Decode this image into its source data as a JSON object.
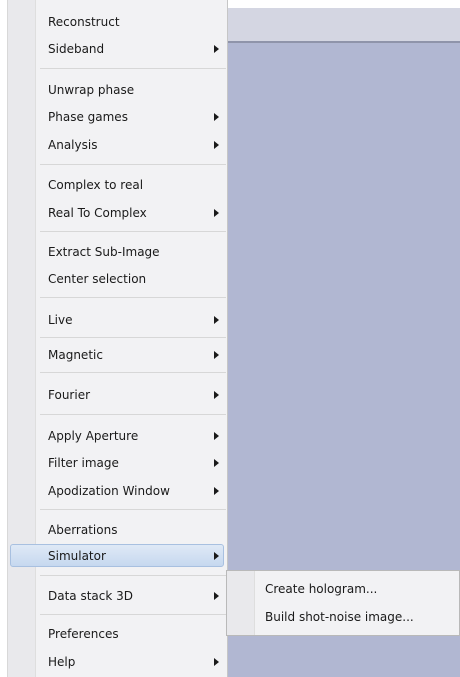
{
  "menu": {
    "items": [
      {
        "label": "Reconstruct",
        "submenu": false
      },
      {
        "label": "Sideband",
        "submenu": true
      },
      {
        "label": "Unwrap phase",
        "submenu": false
      },
      {
        "label": "Phase games",
        "submenu": true
      },
      {
        "label": "Analysis",
        "submenu": true
      },
      {
        "label": "Complex to real",
        "submenu": false
      },
      {
        "label": "Real To Complex",
        "submenu": true
      },
      {
        "label": "Extract Sub-Image",
        "submenu": false
      },
      {
        "label": "Center selection",
        "submenu": false
      },
      {
        "label": "Live",
        "submenu": true
      },
      {
        "label": "Magnetic",
        "submenu": true
      },
      {
        "label": "Fourier",
        "submenu": true
      },
      {
        "label": "Apply Aperture",
        "submenu": true
      },
      {
        "label": "Filter image",
        "submenu": true
      },
      {
        "label": "Apodization Window",
        "submenu": true
      },
      {
        "label": "Aberrations",
        "submenu": false
      },
      {
        "label": "Simulator",
        "submenu": true
      },
      {
        "label": "Data stack 3D",
        "submenu": true
      },
      {
        "label": "Preferences",
        "submenu": false
      },
      {
        "label": "Help",
        "submenu": true
      }
    ]
  },
  "submenu": {
    "items": [
      {
        "label": "Create hologram..."
      },
      {
        "label": "Build shot-noise image..."
      }
    ]
  }
}
